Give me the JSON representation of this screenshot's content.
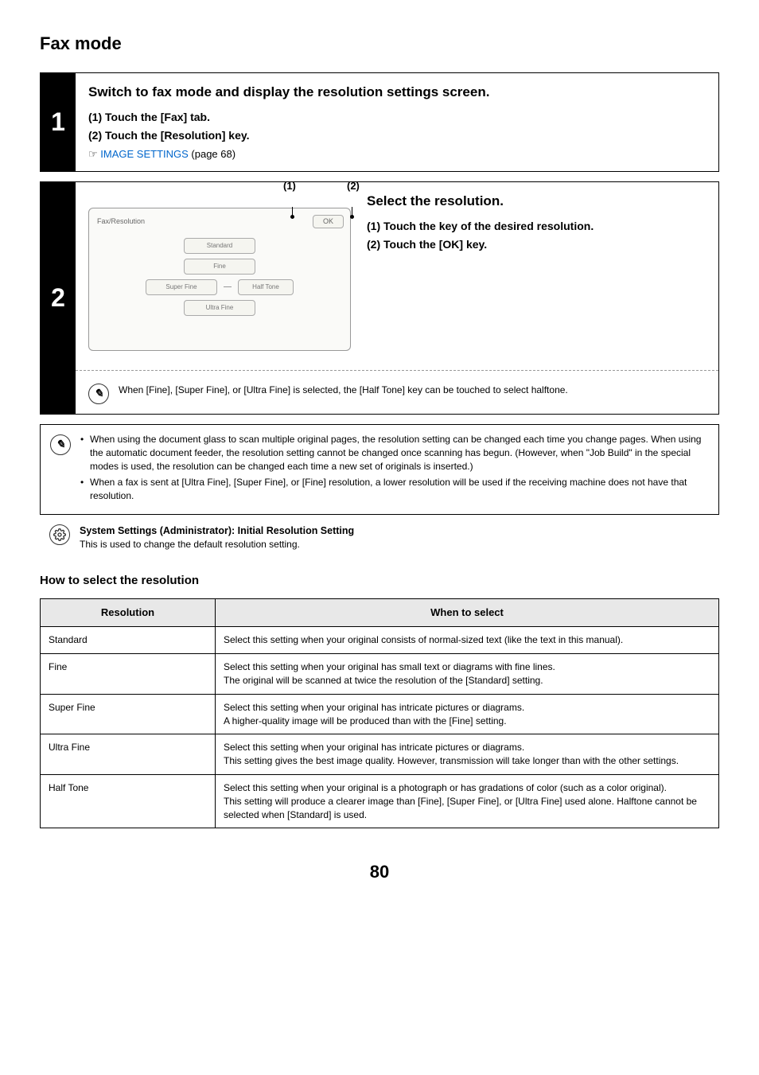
{
  "title": "Fax mode",
  "step1": {
    "num": "1",
    "heading": "Switch to fax mode and display the resolution settings screen.",
    "sub1": "(1)   Touch the [Fax] tab.",
    "sub2": "(2)   Touch the [Resolution] key.",
    "pointer": "☞",
    "link": "IMAGE SETTINGS",
    "link_suffix": " (page 68)"
  },
  "step2": {
    "num": "2",
    "c1": "(1)",
    "c2": "(2)",
    "panel_title": "Fax/Resolution",
    "ok": "OK",
    "buttons": {
      "standard": "Standard",
      "fine": "Fine",
      "super_fine": "Super Fine",
      "half_tone": "Half Tone",
      "ultra_fine": "Ultra Fine"
    },
    "heading": "Select the resolution.",
    "sub1": "(1)  Touch the key of the desired resolution.",
    "sub2": "(2)  Touch the [OK] key.",
    "note": "When [Fine], [Super Fine], or [Ultra Fine] is selected, the [Half Tone] key can be touched to select halftone."
  },
  "info": {
    "b1": "When using the document glass to scan multiple original pages, the resolution setting can be changed each time you change pages. When using the automatic document feeder, the resolution setting cannot be changed once scanning has begun. (However, when \"Job Build\" in the special modes is used, the resolution can be changed each time a new set of originals is inserted.)",
    "b2": "When a fax is sent at [Ultra Fine], [Super Fine], or [Fine] resolution, a lower resolution will be used if the receiving machine does not have that resolution."
  },
  "sys": {
    "title": "System Settings (Administrator): Initial Resolution Setting",
    "text": "This is used to change the default resolution setting."
  },
  "howto": "How to select the resolution",
  "table": {
    "h1": "Resolution",
    "h2": "When to select",
    "rows": [
      {
        "r": "Standard",
        "w": "Select this setting when your original consists of normal-sized text (like the text in this manual)."
      },
      {
        "r": "Fine",
        "w": "Select this setting when your original has small text or diagrams with fine lines.\nThe original will be scanned at twice the resolution of the [Standard] setting."
      },
      {
        "r": "Super Fine",
        "w": "Select this setting when your original has intricate pictures or diagrams.\nA higher-quality image will be produced than with the [Fine] setting."
      },
      {
        "r": "Ultra Fine",
        "w": "Select this setting when your original has intricate pictures or diagrams.\nThis setting gives the best image quality. However, transmission will take longer than with the other settings."
      },
      {
        "r": "Half Tone",
        "w": "Select this setting when your original is a photograph or has gradations of color (such as a color original).\nThis setting will produce a clearer image than [Fine], [Super Fine], or [Ultra Fine] used alone. Halftone cannot be selected when [Standard] is used."
      }
    ]
  },
  "page_num": "80"
}
